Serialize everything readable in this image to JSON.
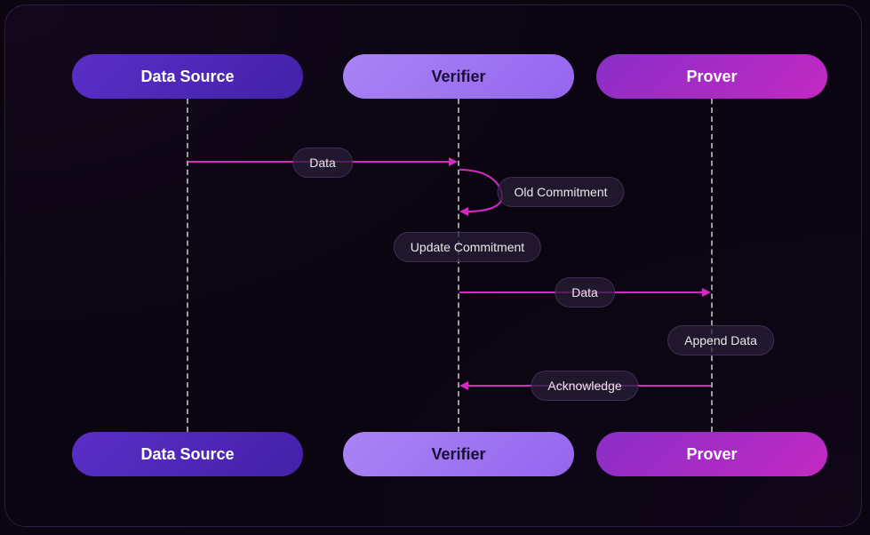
{
  "actors": {
    "dataSource": "Data Source",
    "verifier": "Verifier",
    "prover": "Prover"
  },
  "messages": {
    "data1": "Data",
    "oldCommitment": "Old Commitment",
    "updateCommitment": "Update Commitment",
    "data2": "Data",
    "appendData": "Append Data",
    "acknowledge": "Acknowledge"
  },
  "diagram": {
    "type": "sequence",
    "participants": [
      "Data Source",
      "Verifier",
      "Prover"
    ],
    "steps": [
      {
        "from": "Data Source",
        "to": "Verifier",
        "label": "Data"
      },
      {
        "from": "Verifier",
        "to": "Verifier",
        "label": "Old Commitment",
        "self": true
      },
      {
        "from": "Verifier",
        "to": "Verifier",
        "label": "Update Commitment",
        "self": true,
        "note": true
      },
      {
        "from": "Verifier",
        "to": "Prover",
        "label": "Data"
      },
      {
        "from": "Prover",
        "to": "Prover",
        "label": "Append Data",
        "self": true,
        "note": true
      },
      {
        "from": "Prover",
        "to": "Verifier",
        "label": "Acknowledge"
      }
    ]
  }
}
